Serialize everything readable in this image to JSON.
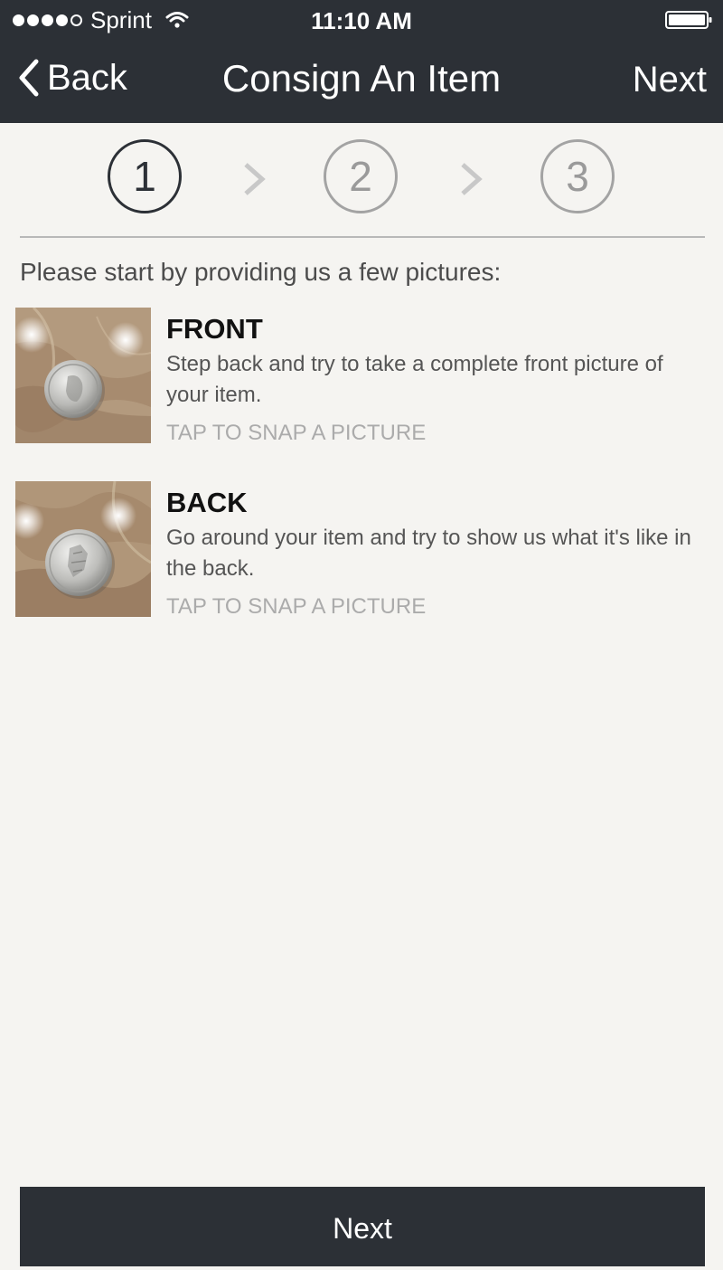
{
  "status_bar": {
    "carrier": "Sprint",
    "time": "11:10 AM",
    "signal_bars_filled": 4,
    "signal_bars_total": 5
  },
  "nav": {
    "back_label": "Back",
    "title": "Consign An Item",
    "next_label": "Next"
  },
  "steps": [
    {
      "label": "1",
      "active": true
    },
    {
      "label": "2",
      "active": false
    },
    {
      "label": "3",
      "active": false
    }
  ],
  "intro_text": "Please start by providing us a few pictures:",
  "items": [
    {
      "title": "FRONT",
      "description": "Step back and try to take a complete front picture of your item.",
      "action": "TAP TO SNAP A PICTURE"
    },
    {
      "title": "BACK",
      "description": "Go around your item and try to show us what it's like in the back.",
      "action": "TAP TO SNAP A PICTURE"
    }
  ],
  "bottom_button_label": "Next",
  "colors": {
    "header_bg": "#2c3036",
    "page_bg": "#f5f4f1",
    "muted_text": "#ababab"
  }
}
